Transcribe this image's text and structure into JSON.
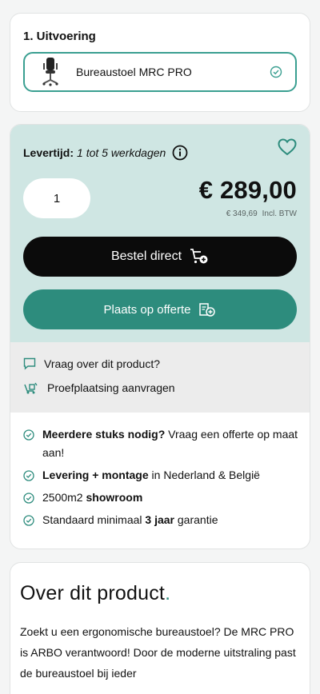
{
  "uitvoering": {
    "title": "1. Uitvoering",
    "variant_label": "Bureaustoel MRC PRO",
    "variant_icon": "chair-icon",
    "selected_icon": "check-circle-icon"
  },
  "order": {
    "lead_time_label": "Levertijd:",
    "lead_time_value": "1 tot 5 werkdagen",
    "quantity": "1",
    "price": "€ 289,00",
    "price_incl": "€ 349,69",
    "price_incl_label": "Incl. BTW",
    "order_button": "Bestel direct",
    "quote_button": "Plaats op offerte",
    "links": [
      {
        "label": "Vraag over dit product?",
        "icon": "chat-icon"
      },
      {
        "label": "Proefplaatsing aanvragen",
        "icon": "delivery-icon"
      }
    ],
    "usps": [
      {
        "bold": "Meerdere stuks nodig?",
        "text": " Vraag een offerte op maat aan!"
      },
      {
        "bold": "Levering + montage",
        "text": " in Nederland & België"
      },
      {
        "pre": "2500m2 ",
        "bold": "showroom",
        "text": ""
      },
      {
        "pre": "Standaard minimaal ",
        "bold": "3 jaar",
        "text": " garantie"
      }
    ]
  },
  "about": {
    "title": "Over dit product",
    "title_dot": ".",
    "text": "Zoekt u een ergonomische bureaustoel? De MRC PRO is ARBO verantwoord! Door de moderne uitstraling past de bureaustoel bij ieder"
  },
  "colors": {
    "accent": "#2d8c7d",
    "accent_light": "#cfe6e3",
    "dark": "#0b0b0b"
  }
}
